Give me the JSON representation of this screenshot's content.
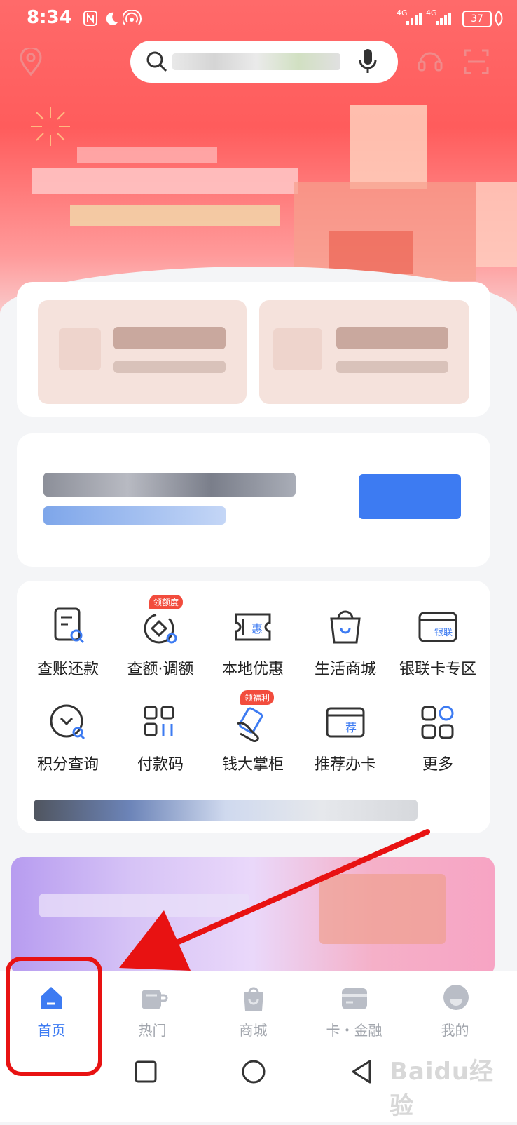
{
  "status_bar": {
    "time": "8:34",
    "battery": "37",
    "signal_1": "4G",
    "signal_2": "4G"
  },
  "search": {
    "placeholder": ""
  },
  "colors": {
    "accent": "#3d7bf2",
    "hero_red": "#ff5c5c",
    "annotation_red": "#e81212"
  },
  "services": [
    {
      "label": "查账还款",
      "icon": "bill-search-icon"
    },
    {
      "label": "查额·调额",
      "icon": "limit-adjust-icon",
      "badge": "领额度"
    },
    {
      "label": "本地优惠",
      "icon": "local-coupon-icon",
      "icon_text": "惠"
    },
    {
      "label": "生活商城",
      "icon": "shopping-bag-icon"
    },
    {
      "label": "银联卡专区",
      "icon": "unionpay-card-icon",
      "icon_text": "银联"
    },
    {
      "label": "积分查询",
      "icon": "points-search-icon"
    },
    {
      "label": "付款码",
      "icon": "payment-code-icon"
    },
    {
      "label": "钱大掌柜",
      "icon": "money-hand-icon",
      "badge": "领福利"
    },
    {
      "label": "推荐办卡",
      "icon": "recommend-card-icon",
      "icon_text": "荐"
    },
    {
      "label": "更多",
      "icon": "more-icon"
    }
  ],
  "bottom_nav": [
    {
      "label": "首页",
      "icon": "home-icon",
      "active": true
    },
    {
      "label": "热门",
      "icon": "cup-icon",
      "active": false
    },
    {
      "label": "商城",
      "icon": "bag-icon",
      "active": false
    },
    {
      "label": "卡・金融",
      "icon": "card-icon",
      "active": false
    },
    {
      "label": "我的",
      "icon": "avatar-icon",
      "active": false
    }
  ],
  "watermark": "Baidu经验"
}
